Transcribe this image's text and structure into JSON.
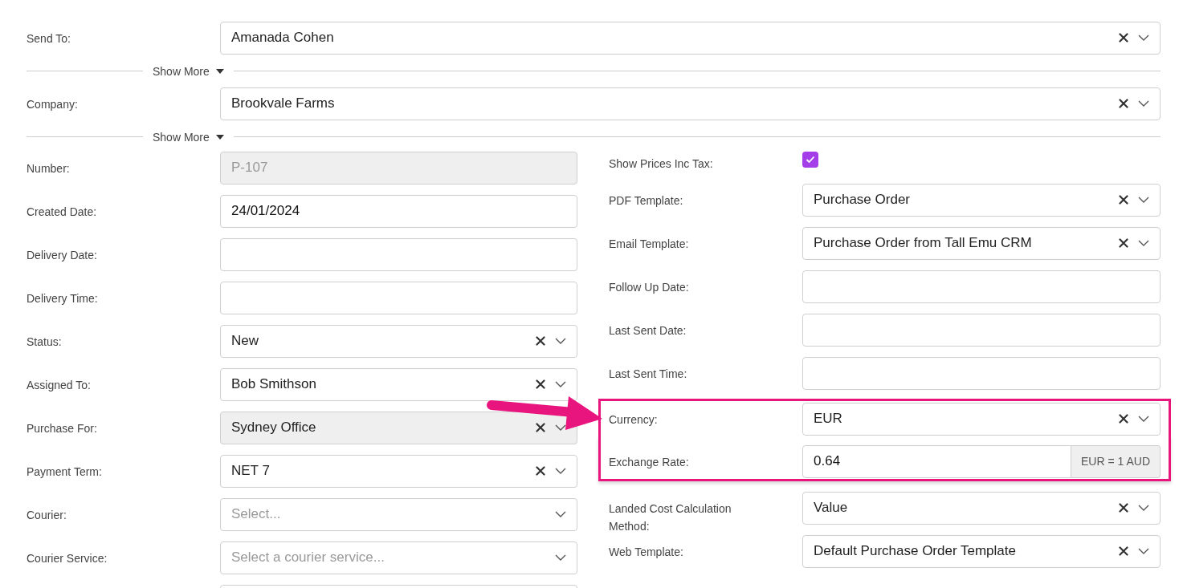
{
  "top_fields": [
    {
      "label": "Send To:",
      "kind": "select",
      "value": "Amanada Cohen",
      "disabled": false,
      "show_more": "Show More"
    },
    {
      "label": "Company:",
      "kind": "select",
      "value": "Brookvale Farms",
      "disabled": false,
      "show_more": "Show More"
    }
  ],
  "left_fields": [
    {
      "label": "Number:",
      "kind": "input",
      "value": "P-107",
      "disabled": true
    },
    {
      "label": "Created Date:",
      "kind": "input",
      "value": "24/01/2024",
      "disabled": false
    },
    {
      "label": "Delivery Date:",
      "kind": "input",
      "disabled": false
    },
    {
      "label": "Delivery Time:",
      "kind": "input",
      "disabled": false
    },
    {
      "label": "Status:",
      "kind": "select",
      "value": "New",
      "disabled": false
    },
    {
      "label": "Assigned To:",
      "kind": "select",
      "value": "Bob Smithson",
      "disabled": false
    },
    {
      "label": "Purchase For:",
      "kind": "select",
      "value": "Sydney Office",
      "disabled": true
    },
    {
      "label": "Payment Term:",
      "kind": "select",
      "value": "NET 7",
      "disabled": false
    },
    {
      "label": "Courier:",
      "kind": "select",
      "placeholder": "Select...",
      "disabled": false
    },
    {
      "label": "Courier Service:",
      "kind": "select",
      "placeholder": "Select a courier service...",
      "disabled": false
    },
    {
      "kind": "input"
    }
  ],
  "right_fields": [
    {
      "label": "Show Prices Inc Tax:",
      "kind": "checkbox",
      "checked": true,
      "highlighted": false
    },
    {
      "label": "PDF Template:",
      "kind": "select",
      "value": "Purchase Order",
      "highlighted": false
    },
    {
      "label": "Email Template:",
      "kind": "select",
      "value": "Purchase Order from Tall Emu CRM",
      "highlighted": false
    },
    {
      "label": "Follow Up Date:",
      "kind": "input",
      "highlighted": false
    },
    {
      "label": "Last Sent Date:",
      "kind": "input",
      "highlighted": false
    },
    {
      "label": "Last Sent Time:",
      "kind": "input",
      "highlighted": false
    },
    {
      "label": "Currency:",
      "kind": "select",
      "value": "EUR",
      "highlighted": true
    },
    {
      "label": "Exchange Rate:",
      "kind": "addon",
      "value": "0.64",
      "addon": "EUR = 1 AUD",
      "highlighted": true
    },
    {
      "label": "Landed Cost Calculation Method:",
      "kind": "select",
      "value": "Value",
      "highlighted": false
    },
    {
      "label": "Web Template:",
      "kind": "select",
      "value": "Default Purchase Order Template",
      "highlighted": false
    }
  ]
}
